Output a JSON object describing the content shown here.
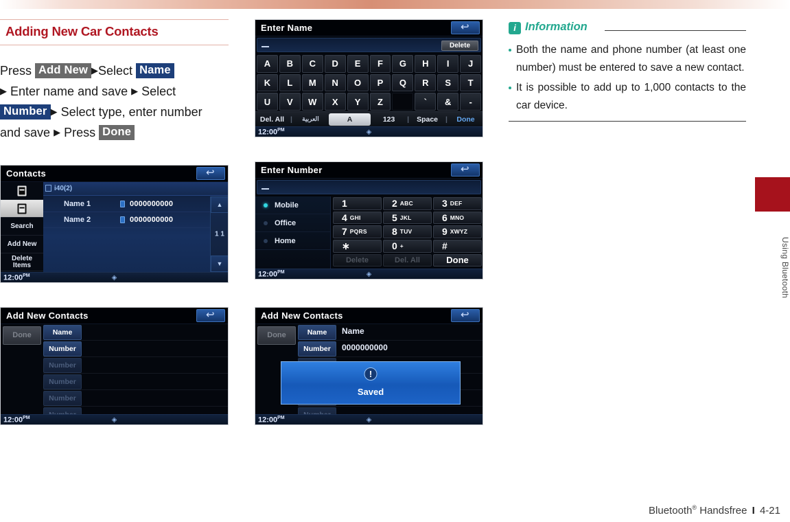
{
  "section": {
    "title": "Adding New Car Contacts"
  },
  "steps": {
    "line1_pre": "Press",
    "key_add_new": "Add New",
    "line1_mid": "Select",
    "key_name": "Name",
    "line2": "Enter name and save",
    "line2_sel": "Select",
    "key_number": "Number",
    "line3": "Select type, enter number",
    "line4_pre": "and save",
    "line4_press": "Press",
    "key_done": "Done",
    "arrow": "▶"
  },
  "shot_contacts": {
    "title": "Contacts",
    "device_tab": "i40(2)",
    "sidebar": {
      "icon_phone_contacts": "phonebook-icon",
      "icon_car_contacts": "car-contacts-icon",
      "search": "Search",
      "add_new": "Add New",
      "delete_items": "Delete\nItems",
      "delete_items_l1": "Delete",
      "delete_items_l2": "Items"
    },
    "rows": [
      {
        "name": "Name 1",
        "number": "0000000000"
      },
      {
        "name": "Name 2",
        "number": "0000000000"
      }
    ],
    "scroll": {
      "up": "▲",
      "down": "▼",
      "page": "1",
      "total": "1"
    },
    "status": {
      "time": "12:00",
      "meridiem": "PM",
      "bt": "bluetooth-icon"
    }
  },
  "shot_addnew": {
    "title": "Add New Contacts",
    "done": "Done",
    "rows": [
      {
        "label": "Name",
        "dim": false
      },
      {
        "label": "Number",
        "dim": false
      },
      {
        "label": "Number",
        "dim": true
      },
      {
        "label": "Number",
        "dim": true
      },
      {
        "label": "Number",
        "dim": true
      },
      {
        "label": "Number",
        "dim": true
      }
    ],
    "status": {
      "time": "12:00",
      "meridiem": "PM"
    }
  },
  "shot_name": {
    "title": "Enter Name",
    "field_value": "",
    "delete": "Delete",
    "rows": [
      [
        "A",
        "B",
        "C",
        "D",
        "E",
        "F",
        "G",
        "H",
        "I",
        "J"
      ],
      [
        "K",
        "L",
        "M",
        "N",
        "O",
        "P",
        "Q",
        "R",
        "S",
        "T"
      ],
      [
        "U",
        "V",
        "W",
        "X",
        "Y",
        "Z",
        "",
        "`",
        "&",
        "-"
      ]
    ],
    "bottom": {
      "del_all": "Del. All",
      "arabic": "العربية",
      "case": "A",
      "numeric": "123",
      "space": "Space",
      "done": "Done",
      "sep": "|"
    },
    "status": {
      "time": "12:00",
      "meridiem": "PM"
    }
  },
  "shot_number": {
    "title": "Enter Number",
    "field_value": "",
    "types": [
      {
        "label": "Mobile",
        "selected": true
      },
      {
        "label": "Office",
        "selected": false
      },
      {
        "label": "Home",
        "selected": false
      }
    ],
    "keys": [
      [
        {
          "d": "1",
          "s": ""
        },
        {
          "d": "2",
          "s": "ABC"
        },
        {
          "d": "3",
          "s": "DEF"
        }
      ],
      [
        {
          "d": "4",
          "s": "GHI"
        },
        {
          "d": "5",
          "s": "JKL"
        },
        {
          "d": "6",
          "s": "MNO"
        }
      ],
      [
        {
          "d": "7",
          "s": "PQRS"
        },
        {
          "d": "8",
          "s": "TUV"
        },
        {
          "d": "9",
          "s": "XWYZ"
        }
      ],
      [
        {
          "d": "∗",
          "s": ""
        },
        {
          "d": "0",
          "s": "+"
        },
        {
          "d": "#",
          "s": ""
        }
      ]
    ],
    "actions": {
      "delete": "Delete",
      "del_all": "Del. All",
      "done": "Done"
    },
    "status": {
      "time": "12:00",
      "meridiem": "PM"
    }
  },
  "shot_saved": {
    "title": "Add New Contacts",
    "done": "Done",
    "rows": [
      {
        "label": "Name",
        "value": "Name",
        "dim": false
      },
      {
        "label": "Number",
        "value": "0000000000",
        "dim": false
      },
      {
        "label": "Number",
        "value": "",
        "dim": true
      },
      {
        "label": "Number",
        "value": "",
        "dim": true
      },
      {
        "label": "Number",
        "value": "",
        "dim": true
      },
      {
        "label": "Number",
        "value": "",
        "dim": true
      }
    ],
    "dialog": {
      "icon": "exclamation-icon",
      "glyph": "!",
      "message": "Saved"
    },
    "status": {
      "time": "12:00",
      "meridiem": "PM"
    }
  },
  "information": {
    "badge": "i",
    "title": "Information",
    "items": [
      "Both the name and phone number (at least one number) must be entered to save a new contact.",
      "It is possible to add up to 1,000 contacts to the car device."
    ]
  },
  "side_tab": {
    "label": "Using Bluetooth"
  },
  "footer": {
    "book": "Bluetooth",
    "mark": "®",
    "section": "Handsfree",
    "sep": "I",
    "page": "4-21"
  },
  "colors": {
    "accent_red": "#b01722",
    "tab_red": "#a6121c",
    "info_green": "#23a88f",
    "key_blue": "#1d3f7a",
    "key_grey": "#6a6a6a"
  }
}
